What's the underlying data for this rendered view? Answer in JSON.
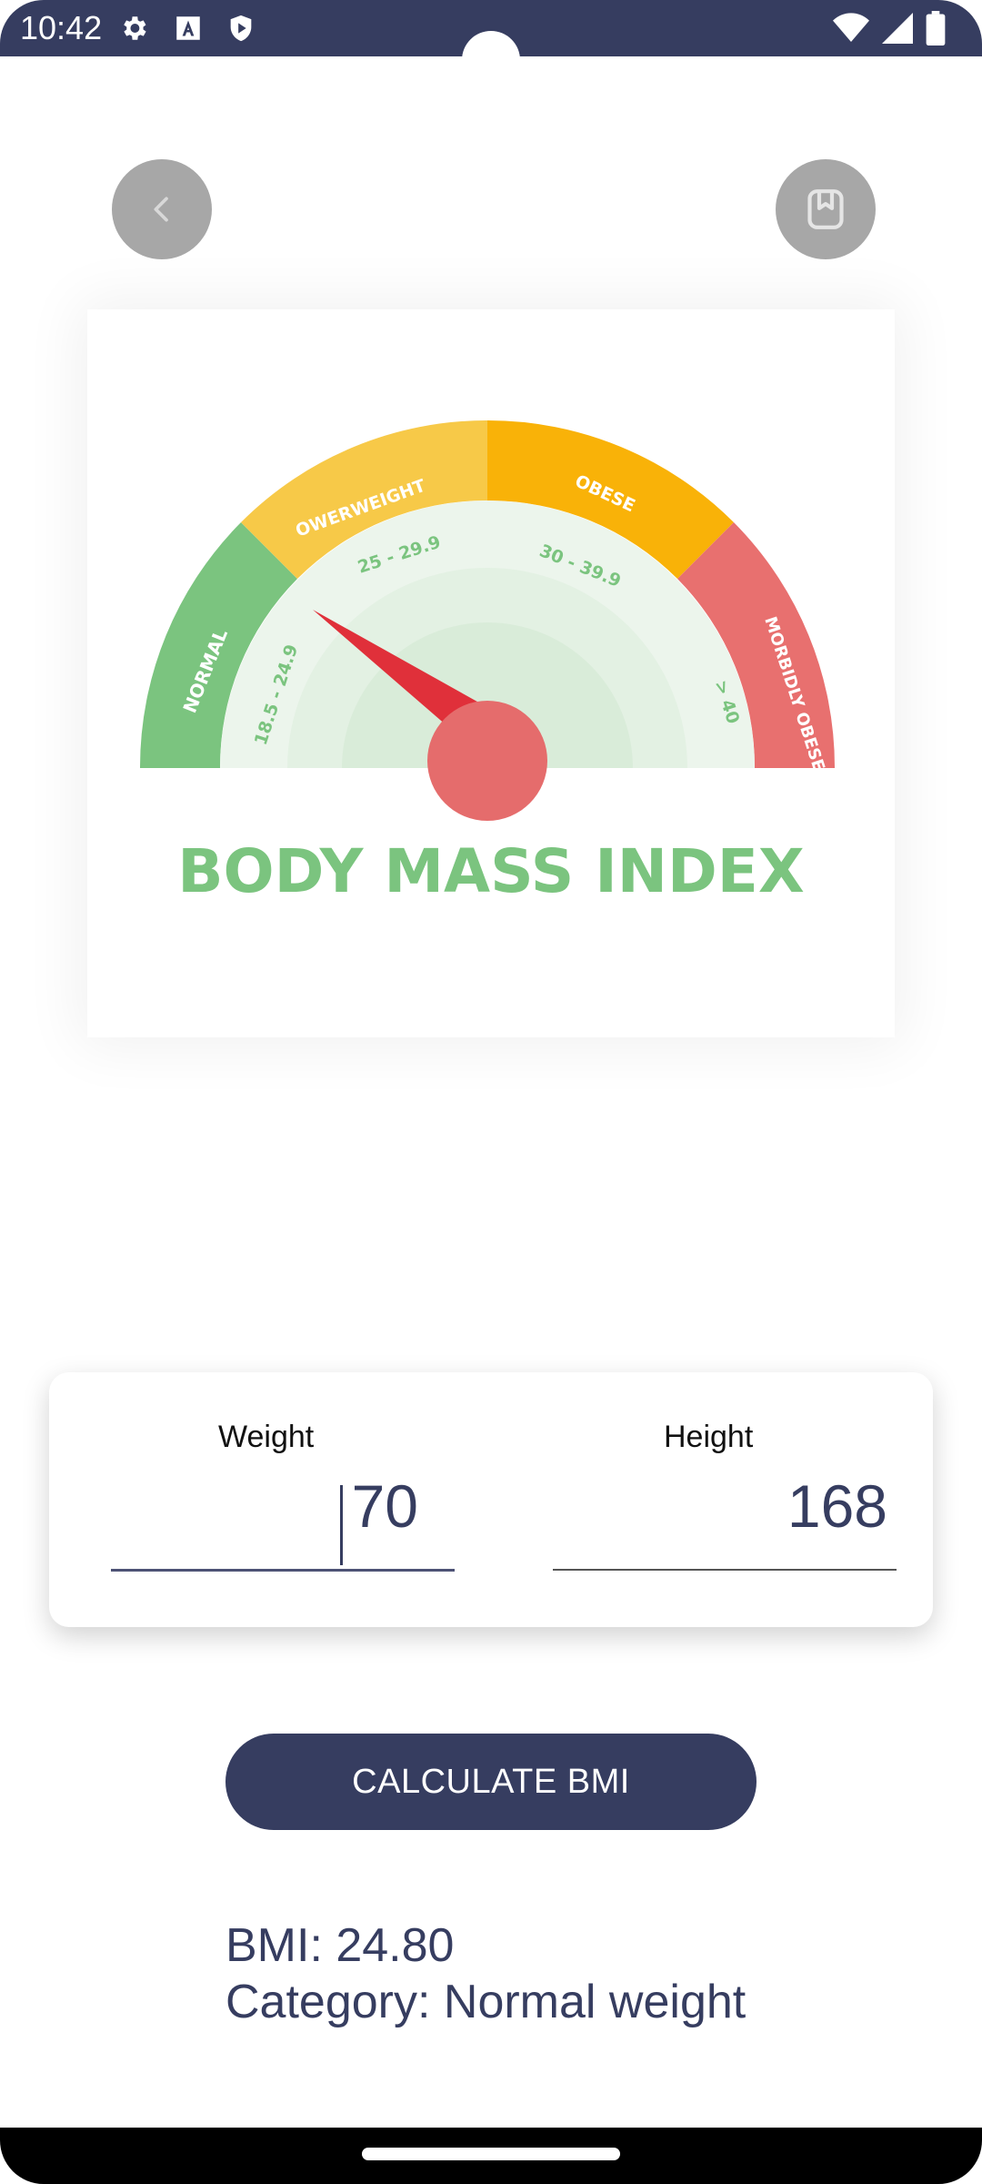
{
  "status_bar": {
    "time": "10:42",
    "left_icons": [
      "gear-icon",
      "font-a-icon",
      "shield-play-icon"
    ],
    "right_icons": [
      "wifi-icon",
      "cell-signal-icon",
      "battery-icon"
    ],
    "color": "#363d60"
  },
  "header": {
    "back_icon": "chevron-left-icon",
    "bookmark_icon": "bookmark-icon"
  },
  "gauge": {
    "title": "BODY MASS INDEX",
    "segments": [
      {
        "label": "NORMAL",
        "range": "18.5 - 24.9",
        "color": "#7bc47f"
      },
      {
        "label": "OWERWEIGHT",
        "range": "25 - 29.9",
        "color": "#f7c948"
      },
      {
        "label": "OBESE",
        "range": "30 - 39.9",
        "color": "#f9b208"
      },
      {
        "label": "MORBIDLY OBESE",
        "range": "> 40",
        "color": "#e8706f"
      }
    ],
    "needle_value_bmi": 21
  },
  "form": {
    "weight_label": "Weight",
    "weight_value": "70",
    "height_label": "Height",
    "height_value": "168"
  },
  "button": {
    "calculate_label": "CALCULATE BMI"
  },
  "result": {
    "bmi_text": "BMI: 24.80",
    "category_text": "Category: Normal weight"
  }
}
